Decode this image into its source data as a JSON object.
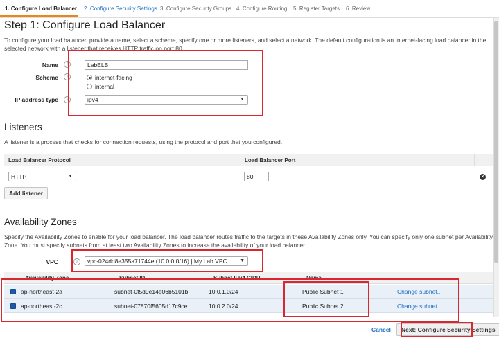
{
  "wizard": {
    "steps": [
      "1. Configure Load Balancer",
      "2. Configure Security Settings",
      "3. Configure Security Groups",
      "4. Configure Routing",
      "5. Register Targets",
      "6. Review"
    ]
  },
  "step1": {
    "title": "Step 1: Configure Load Balancer",
    "intro": "To configure your load balancer, provide a name, select a scheme, specify one or more listeners, and select a network. The default configuration is an Internet-facing load balancer in the selected network with a listener that receives HTTP traffic on port 80.",
    "name_label": "Name",
    "name_value": "LabELB",
    "scheme_label": "Scheme",
    "scheme_options": [
      "internet-facing",
      "internal"
    ],
    "ip_label": "IP address type",
    "ip_value": "ipv4"
  },
  "listeners": {
    "title": "Listeners",
    "desc": "A listener is a process that checks for connection requests, using the protocol and port that you configured.",
    "col_protocol": "Load Balancer Protocol",
    "col_port": "Load Balancer Port",
    "protocol_value": "HTTP",
    "port_value": "80",
    "add_label": "Add listener"
  },
  "az": {
    "title": "Availability Zones",
    "desc": "Specify the Availability Zones to enable for your load balancer. The load balancer routes traffic to the targets in these Availability Zones only. You can specify only one subnet per Availability Zone. You must specify subnets from at least two Availability Zones to increase the availability of your load balancer.",
    "vpc_label": "VPC",
    "vpc_value": "vpc-024dd8e355a71744e (10.0.0.0/16) | My Lab VPC",
    "columns": [
      "Availability Zone",
      "Subnet ID",
      "Subnet IPv4 CIDR",
      "Name"
    ],
    "rows": [
      {
        "zone": "ap-northeast-2a",
        "subnet": "subnet-0f5d9e14e06b5101b",
        "cidr": "10.0.1.0/24",
        "name": "Public Subnet 1",
        "action": "Change subnet..."
      },
      {
        "zone": "ap-northeast-2c",
        "subnet": "subnet-07870f5605d17c9ce",
        "cidr": "10.0.2.0/24",
        "name": "Public Subnet 2",
        "action": "Change subnet..."
      }
    ]
  },
  "footer": {
    "cancel": "Cancel",
    "next": "Next: Configure Security Settings"
  },
  "colors": {
    "accent": "#e7861a",
    "link": "#1f6fc3",
    "highlight": "#d9262f"
  }
}
